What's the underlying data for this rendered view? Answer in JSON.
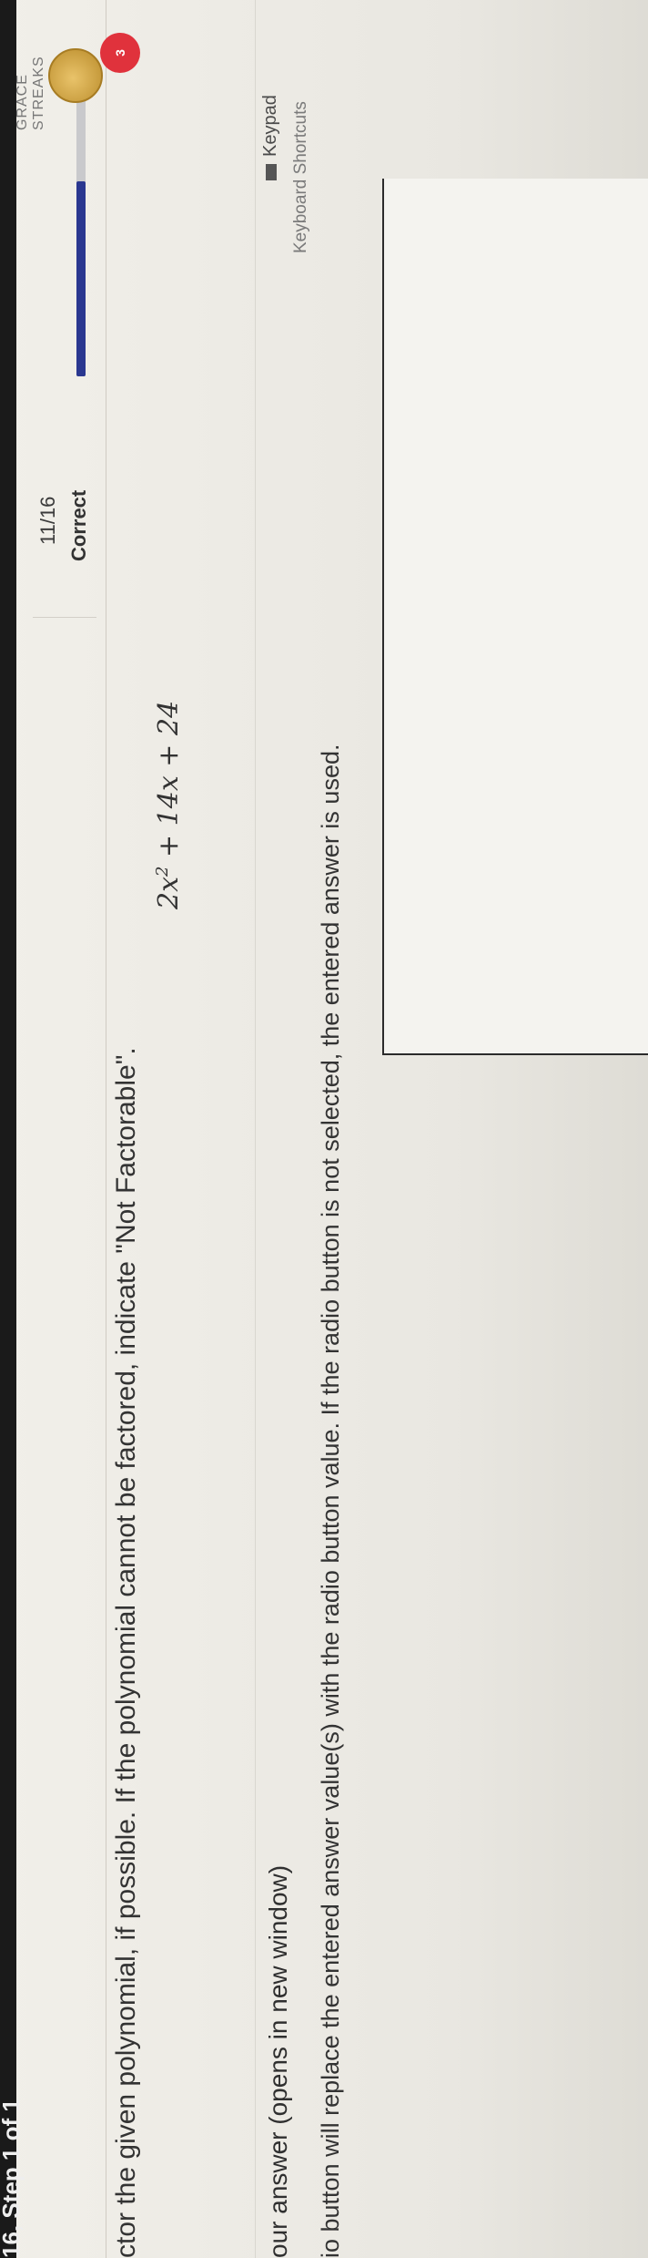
{
  "header": {
    "step": "16, Step 1 of 1",
    "progress_count": "11/16",
    "progress_status": "Correct",
    "progress_fraction": 0.69,
    "streaks_label": "GRACE STREAKS",
    "heart_count": "3"
  },
  "question": {
    "prompt": "ctor the given polynomial, if possible. If the polynomial cannot be factored, indicate \"Not Factorable\".",
    "math_base": "2x",
    "math_exp": "2",
    "math_rest": " + 14x + 24"
  },
  "tools": {
    "keypad_label": "Keypad",
    "shortcuts_label": "Keyboard Shortcuts"
  },
  "answer": {
    "label": "our answer (opens in new window)",
    "radio_note": "io button will replace the entered answer value(s) with the radio button value. If the radio button is not selected, the entered answer is used."
  },
  "colors": {
    "progress_fill": "#2a3790",
    "heart": "#e0323c",
    "coin": "#d4a949"
  }
}
